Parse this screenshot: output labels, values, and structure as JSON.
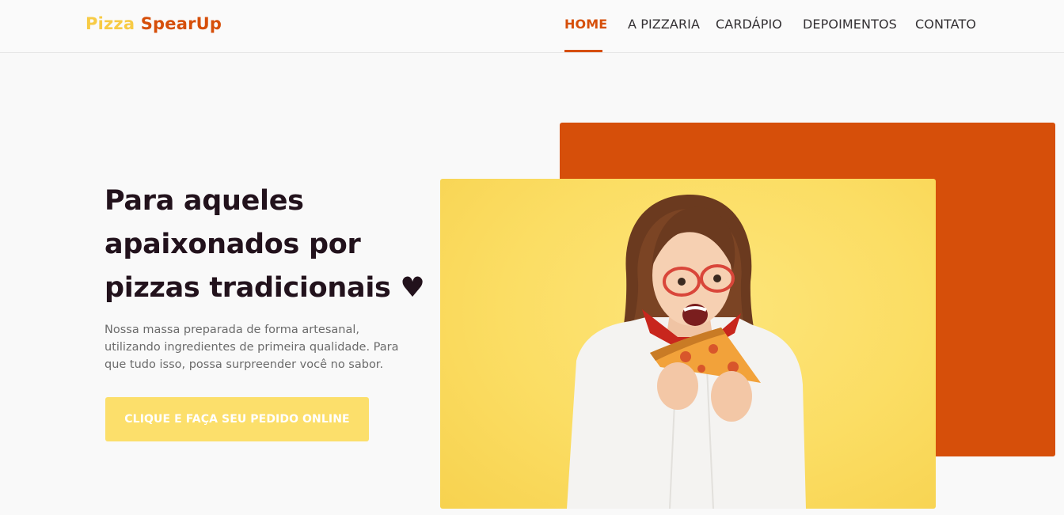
{
  "brand": {
    "first": "Pizza",
    "second": "SpearUp",
    "color_first": "#f7cb45",
    "color_second": "#d64f0a"
  },
  "nav": {
    "items": [
      {
        "label": "HOME",
        "active": true
      },
      {
        "label": "A PIZZARIA",
        "active": false
      },
      {
        "label": "CARDÁPIO",
        "active": false
      },
      {
        "label": "DEPOIMENTOS",
        "active": false
      },
      {
        "label": "CONTATO",
        "active": false
      }
    ]
  },
  "hero": {
    "headline_lines": [
      "Para aqueles",
      "apaixonados por",
      "pizzas tradicionais ♥"
    ],
    "description_lines": [
      "Nossa massa preparada de forma artesanal,",
      "utilizando ingredientes de primeira qualidade. Para",
      "que tudo isso, possa surpreender você no sabor."
    ],
    "cta_label": "CLIQUE E FAÇA SEU PEDIDO ONLINE",
    "image_icon": "woman-eating-pizza-photo"
  },
  "colors": {
    "accent": "#d64f0a",
    "yellow": "#fcdf6b",
    "headline": "#22121c",
    "text": "#6b6b6b"
  }
}
